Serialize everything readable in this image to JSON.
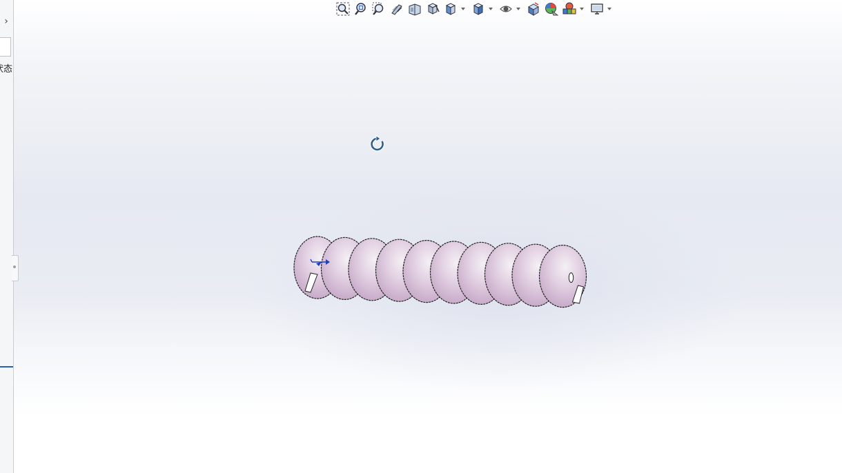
{
  "left_panel": {
    "expand_glyph": "›",
    "status_text": "状态"
  },
  "toolbar": {
    "icons": [
      "zoom-to-fit-icon",
      "zoom-to-area-icon",
      "previous-view-icon",
      "section-view-icon",
      "dynamic-annotation-view-icon",
      "view-orientation-icon",
      "display-style-icon",
      "hide-show-items-icon",
      "edit-appearance-icon",
      "apply-scene-icon",
      "view-settings-icon",
      "display-icon"
    ]
  },
  "model": {
    "name": "helical-screw-flight",
    "turns": 10,
    "colors": {
      "surface_light": "#f3eef4",
      "surface_mid": "#dcc4dc",
      "edge": "#222222",
      "triad": "#1f3fbf"
    }
  }
}
